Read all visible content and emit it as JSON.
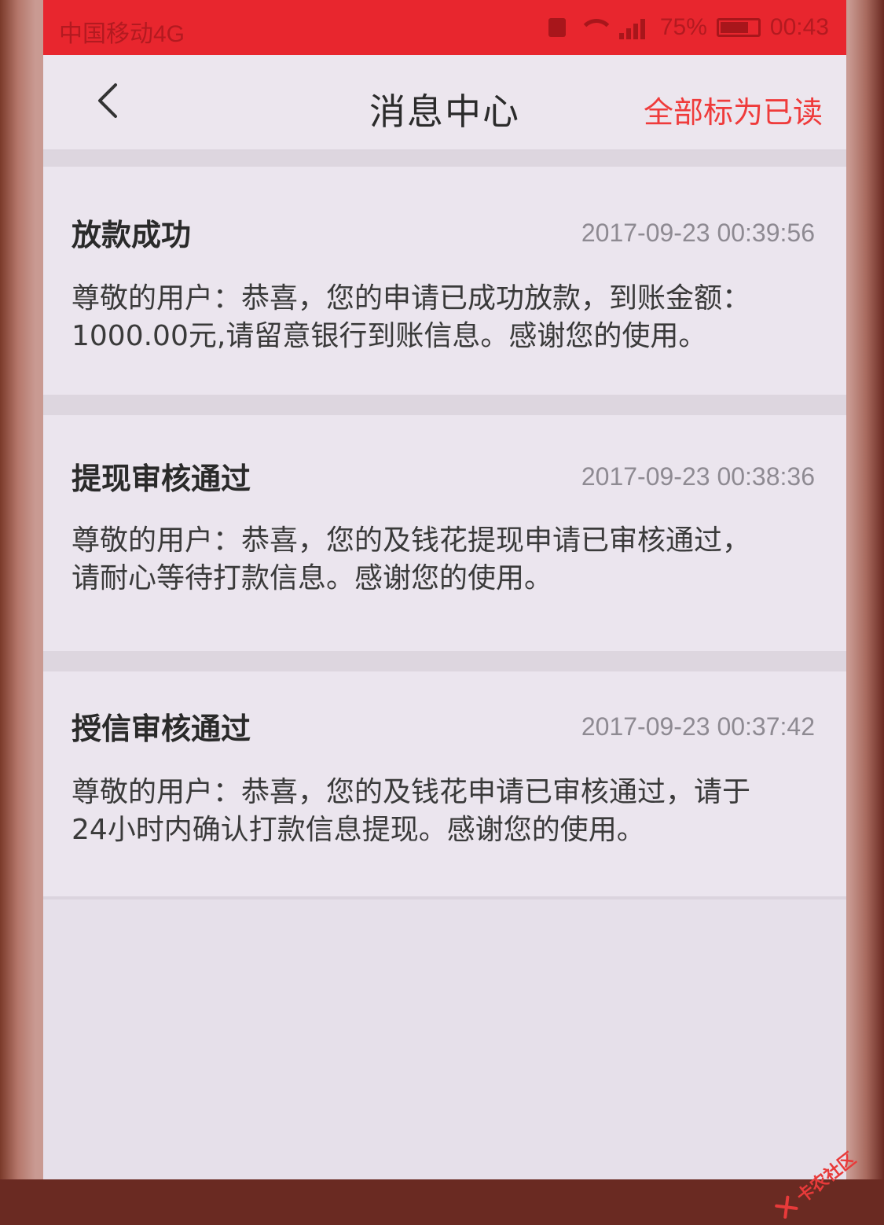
{
  "status_bar": {
    "carrier": "中国移动4G",
    "battery": "75%",
    "time": "00:43"
  },
  "nav": {
    "title": "消息中心",
    "mark_all_read": "全部标为已读"
  },
  "messages": [
    {
      "title": "放款成功",
      "time": "2017-09-23 00:39:56",
      "body": "尊敬的用户：恭喜，您的申请已成功放款，到账金额：1000.00元,请留意银行到账信息。感谢您的使用。"
    },
    {
      "title": "提现审核通过",
      "time": "2017-09-23 00:38:36",
      "body": "尊敬的用户：恭喜，您的及钱花提现申请已审核通过，请耐心等待打款信息。感谢您的使用。"
    },
    {
      "title": "授信审核通过",
      "time": "2017-09-23 00:37:42",
      "body": "尊敬的用户：恭喜，您的及钱花申请已审核通过，请于24小时内确认打款信息提现。感谢您的使用。"
    }
  ],
  "watermark": {
    "text": "卡农社区"
  },
  "colors": {
    "status_bar": "#e8262e",
    "accent": "#ef3b3b",
    "background": "#ebe5ee"
  }
}
